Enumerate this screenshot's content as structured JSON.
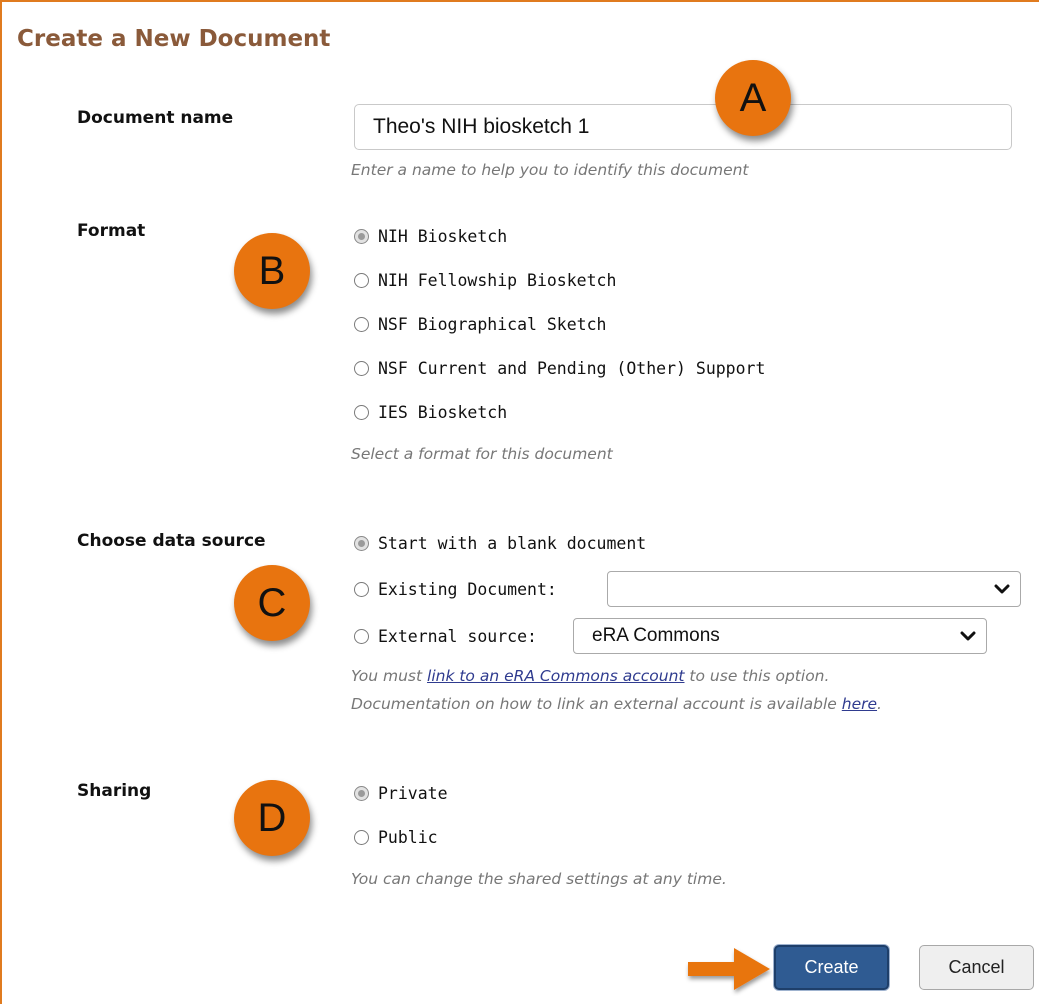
{
  "header": {
    "title": "Create a New Document"
  },
  "document_name": {
    "label": "Document name",
    "value": "Theo's NIH biosketch 1",
    "hint": "Enter a name to help you to identify this document"
  },
  "format": {
    "label": "Format",
    "options": [
      {
        "label": "NIH Biosketch",
        "checked": true
      },
      {
        "label": "NIH Fellowship Biosketch",
        "checked": false
      },
      {
        "label": "NSF Biographical Sketch",
        "checked": false
      },
      {
        "label": "NSF Current and Pending (Other) Support",
        "checked": false
      },
      {
        "label": "IES Biosketch",
        "checked": false
      }
    ],
    "hint": "Select a format for this document"
  },
  "data_source": {
    "label": "Choose data source",
    "blank_label": "Start with a blank document",
    "existing_label": "Existing Document:",
    "existing_value": "",
    "external_label": "External source:",
    "external_value": "eRA Commons",
    "hint_pre": "You must ",
    "hint_link": "link to an eRA Commons account",
    "hint_post": " to use this option.",
    "hint2_pre": "Documentation on how to link an external account is available ",
    "hint2_link": "here",
    "hint2_post": "."
  },
  "sharing": {
    "label": "Sharing",
    "private_label": "Private",
    "public_label": "Public",
    "hint": "You can change the shared settings at any time."
  },
  "callouts": {
    "a": "A",
    "b": "B",
    "c": "C",
    "d": "D"
  },
  "buttons": {
    "create": "Create",
    "cancel": "Cancel"
  },
  "colors": {
    "accent": "#e8740f",
    "title": "#8a5a3a",
    "primary_button": "#2f5b92",
    "link": "#2f3b8f"
  },
  "icons": {
    "select_chevron": "chevron-down-icon",
    "pointer": "arrow-right-icon"
  }
}
